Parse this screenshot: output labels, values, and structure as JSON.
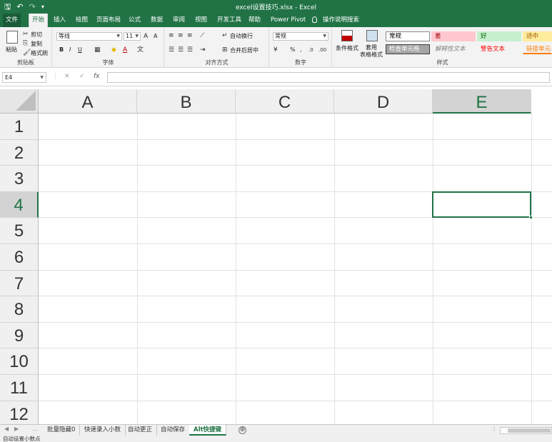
{
  "window": {
    "title": "excel设置技巧.xlsx  -  Excel",
    "qat": {
      "save_icon": "🖫",
      "undo_icon": "↶",
      "redo_icon": "↷",
      "customize_icon": "▾"
    }
  },
  "ribbon_tabs": [
    {
      "label": "文件"
    },
    {
      "label": "开始"
    },
    {
      "label": "插入"
    },
    {
      "label": "绘图"
    },
    {
      "label": "页面布局"
    },
    {
      "label": "公式"
    },
    {
      "label": "数据"
    },
    {
      "label": "审阅"
    },
    {
      "label": "视图"
    },
    {
      "label": "开发工具"
    },
    {
      "label": "帮助"
    },
    {
      "label": "Power Pivot"
    },
    {
      "label": "操作说明搜索"
    }
  ],
  "clipboard": {
    "paste_label": "粘贴",
    "cut_label": "剪切",
    "copy_label": "复制",
    "format_painter_label": "格式刷",
    "group_label": "剪贴板"
  },
  "font": {
    "font_name": "等线",
    "font_size": "11",
    "group_label": "字体",
    "bold": "B",
    "italic": "I",
    "underline": "U",
    "grow": "A",
    "shrink": "A"
  },
  "alignment": {
    "wrap_text": "自动换行",
    "merge_center": "合并后居中",
    "group_label": "对齐方式"
  },
  "number": {
    "format": "常规",
    "percent": "%",
    "comma": ",",
    "group_label": "数字"
  },
  "styles": {
    "conditional_format": "条件格式",
    "format_as_table": "套用\n表格格式",
    "cells": [
      {
        "label": "常规",
        "bg": "#ffffff",
        "color": "#000000",
        "border": "#8c8c8c"
      },
      {
        "label": "差",
        "bg": "#ffc7ce",
        "color": "#9c0006",
        "border": "#ffc7ce"
      },
      {
        "label": "好",
        "bg": "#c6efce",
        "color": "#006100",
        "border": "#c6efce"
      },
      {
        "label": "适中",
        "bg": "#ffeb9c",
        "color": "#9c5700",
        "border": "#ffeb9c"
      },
      {
        "label": "检查单元格",
        "bg": "#a5a5a5",
        "color": "#ffffff",
        "border": "#3f3f3f"
      },
      {
        "label": "解释性文本",
        "bg": "#f3f3f3",
        "color": "#7f7f7f",
        "border": "#f3f3f3"
      },
      {
        "label": "警告文本",
        "bg": "#f3f3f3",
        "color": "#ff0000",
        "border": "#f3f3f3"
      },
      {
        "label": "链接单元格",
        "bg": "#f3f3f3",
        "color": "#fa7d00",
        "border": "#f3f3f3"
      }
    ],
    "group_label": "样式"
  },
  "formula_bar": {
    "name_box": "E4",
    "cancel_icon": "✕",
    "enter_icon": "✓",
    "fx_label": "fx",
    "value": ""
  },
  "grid": {
    "columns": [
      "A",
      "B",
      "C",
      "D",
      "E"
    ],
    "rows": [
      "1",
      "2",
      "3",
      "4",
      "5",
      "6",
      "7",
      "8",
      "9",
      "10",
      "11",
      "12"
    ],
    "selected_cell": "E4",
    "accent": "#217346"
  },
  "sheets": [
    {
      "label": "批量隐藏0"
    },
    {
      "label": "快速录入小数"
    },
    {
      "label": "自动更正"
    },
    {
      "label": "自动保存"
    },
    {
      "label": "Alt快捷键",
      "active": true
    }
  ],
  "add_sheet_icon": "⊕",
  "status_bar": {
    "text": "自动设置小数点"
  }
}
